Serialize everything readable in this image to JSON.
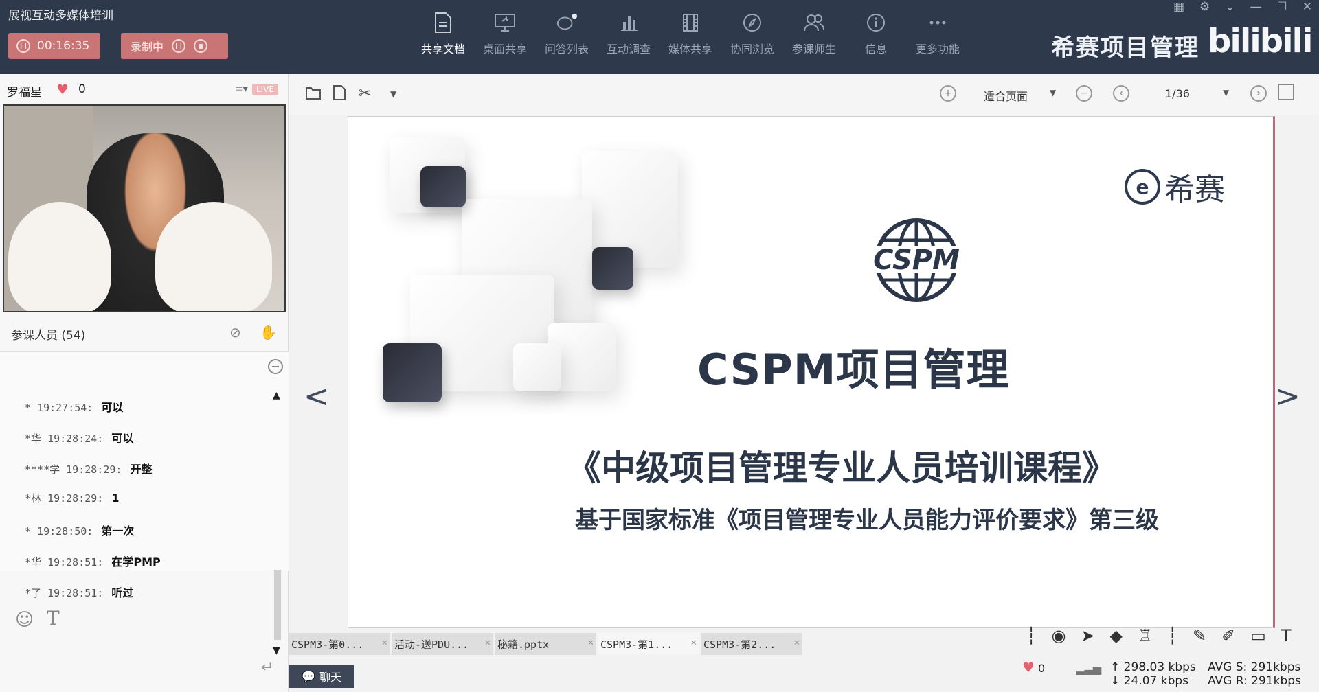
{
  "app": {
    "title": "展视互动多媒体培训",
    "timer": "00:16:35",
    "recording_label": "录制中",
    "brand": "希赛项目管理",
    "bilibili": "bilibili"
  },
  "toolbar": [
    {
      "label": "共享文档",
      "icon": "document-icon",
      "active": true
    },
    {
      "label": "桌面共享",
      "icon": "desktop-icon",
      "active": false
    },
    {
      "label": "问答列表",
      "icon": "qa-icon",
      "active": false
    },
    {
      "label": "互动调查",
      "icon": "bar-chart-icon",
      "active": false
    },
    {
      "label": "媒体共享",
      "icon": "film-icon",
      "active": false
    },
    {
      "label": "协同浏览",
      "icon": "compass-icon",
      "active": false
    },
    {
      "label": "参课师生",
      "icon": "users-icon",
      "active": false
    },
    {
      "label": "信息",
      "icon": "info-icon",
      "active": false
    },
    {
      "label": "更多功能",
      "icon": "more-icon",
      "active": false
    }
  ],
  "presenter": {
    "name": "罗福星",
    "likes": "0",
    "live_badge": "LIVE"
  },
  "participants": {
    "label": "参课人员 (54)"
  },
  "chat": {
    "messages": [
      {
        "who": "* 19:27:54:",
        "text": "可以"
      },
      {
        "who": "*华 19:28:24:",
        "text": "可以"
      },
      {
        "who": "****学 19:28:29:",
        "text": "开整"
      },
      {
        "who": "*林 19:28:29:",
        "text": "1"
      },
      {
        "who": "* 19:28:50:",
        "text": "第一次"
      },
      {
        "who": "*华 19:28:51:",
        "text": "在学PMP"
      },
      {
        "who": "*了 19:28:51:",
        "text": "听过"
      }
    ],
    "tab_label": "聊天"
  },
  "doc": {
    "fit_label": "适合页面",
    "page_indicator": "1/36"
  },
  "slide": {
    "brand": "希赛",
    "logo_text": "CSPM",
    "title": "CSPM项目管理",
    "subtitle": "《中级项目管理专业人员培训课程》",
    "note": "基于国家标准《项目管理专业人员能力评价要求》第三级"
  },
  "tabs": [
    {
      "label": "CSPM3-第0...",
      "active": false
    },
    {
      "label": "活动-送PDU...",
      "active": false
    },
    {
      "label": "秘籍.pptx",
      "active": false
    },
    {
      "label": "CSPM3-第1...",
      "active": true
    },
    {
      "label": "CSPM3-第2...",
      "active": false
    }
  ],
  "status": {
    "likes": "0",
    "upload": "298.03 kbps",
    "download": "24.07 kbps",
    "avg_s": "AVG S: 291kbps",
    "avg_r": "AVG R: 291kbps"
  }
}
